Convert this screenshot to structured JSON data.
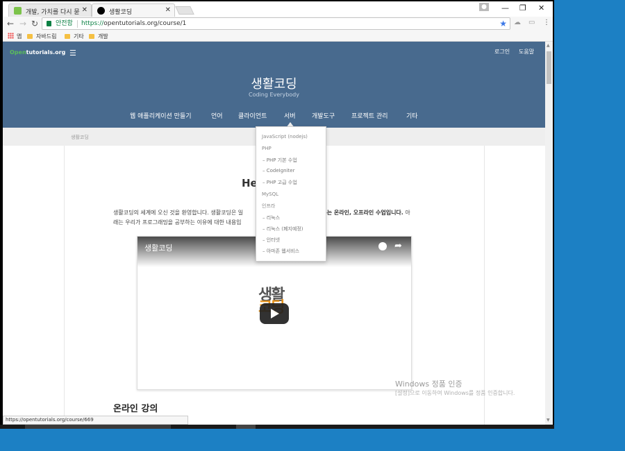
{
  "browser": {
    "tabs": [
      {
        "title": "개발, 가치를 다시 묻습니다"
      },
      {
        "title": "생활코딩"
      }
    ],
    "secure_label": "안전함",
    "url_scheme": "https://",
    "url_rest": "opentutorials.org/course/1",
    "bookmarks": [
      {
        "label": "앱"
      },
      {
        "label": "자바드림"
      },
      {
        "label": "기타"
      },
      {
        "label": "개발"
      }
    ],
    "status_url": "https://opentutorials.org/course/669"
  },
  "site": {
    "logo_open": "Open",
    "logo_rest": "tutorials.org",
    "login": "로그인",
    "help": "도움말",
    "title": "생활코딩",
    "subtitle": "Coding Everybody",
    "nav": [
      {
        "label": "웹 애플리케이션 만들기"
      },
      {
        "label": "언어"
      },
      {
        "label": "클라이언트"
      },
      {
        "label": "서버"
      },
      {
        "label": "개발도구"
      },
      {
        "label": "프로젝트 관리"
      },
      {
        "label": "기타"
      }
    ],
    "breadcrumb": "생활코딩"
  },
  "dropdown": [
    {
      "label": "JavaScript (nodejs)"
    },
    {
      "label": "PHP"
    },
    {
      "label": "– PHP 기본 수업"
    },
    {
      "label": "– CodeIgniter"
    },
    {
      "label": "– PHP 고급 수업"
    },
    {
      "label": "MySQL"
    },
    {
      "label": "인프라"
    },
    {
      "label": "– 리눅스"
    },
    {
      "label": "– 리눅스 (폐지예정)"
    },
    {
      "label": "– 인터넷"
    },
    {
      "label": "– 아마존 웹서비스"
    }
  ],
  "content": {
    "hero_title": "He",
    "intro_1": "생활코딩의 세계에 오신 것을 환영합니다. 생활코딩은 일",
    "intro_bold": "알려주는 온라인, 오프라인 수업입니다.",
    "intro_2": " 아",
    "intro_line2": "래는 우리가 프로그래밍을 공부하는 이유에 대한 내용입",
    "video_title": "생활코딩",
    "video_logo_top": "생활",
    "video_logo_bottom": "코딩",
    "section_title": "온라인 강의"
  },
  "watermark": {
    "title": "Windows 정품 인증",
    "body": "[설정]으로 이동하여 Windows를 정품 인증합니다."
  }
}
